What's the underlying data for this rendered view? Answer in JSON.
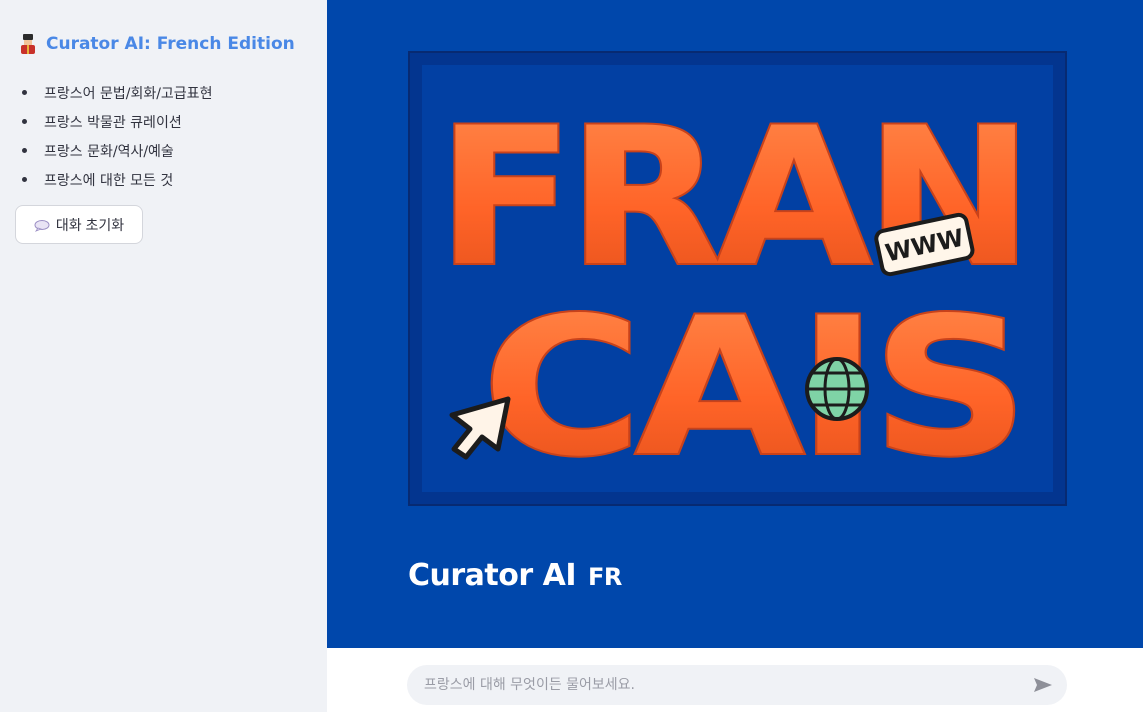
{
  "sidebar": {
    "title": "Curator AI: French Edition",
    "items": [
      {
        "label": "프랑스어 문법/회화/고급표현"
      },
      {
        "label": "프랑스 박물관 큐레이션"
      },
      {
        "label": "프랑스 문화/역사/예술"
      },
      {
        "label": "프랑스에 대한 모든 것"
      }
    ],
    "reset_label": "대화 초기화",
    "icons": {
      "logo": "guard-emoji-icon",
      "reset": "speech-bubble-icon"
    }
  },
  "hero": {
    "words": [
      "FRAN",
      "CAIS"
    ],
    "tag": "WWW",
    "icons": [
      "globe-icon",
      "cursor-arrow-icon"
    ]
  },
  "main": {
    "title": "Curator AI",
    "title_suffix": "FR"
  },
  "chat": {
    "placeholder": "프랑스에 대해 무엇이든 물어보세요.",
    "value": ""
  },
  "colors": {
    "sidebar_bg": "#f0f2f6",
    "accent_blue": "#4a88e6",
    "main_bg": "#0047ab",
    "letters": "#ff6a2a"
  }
}
